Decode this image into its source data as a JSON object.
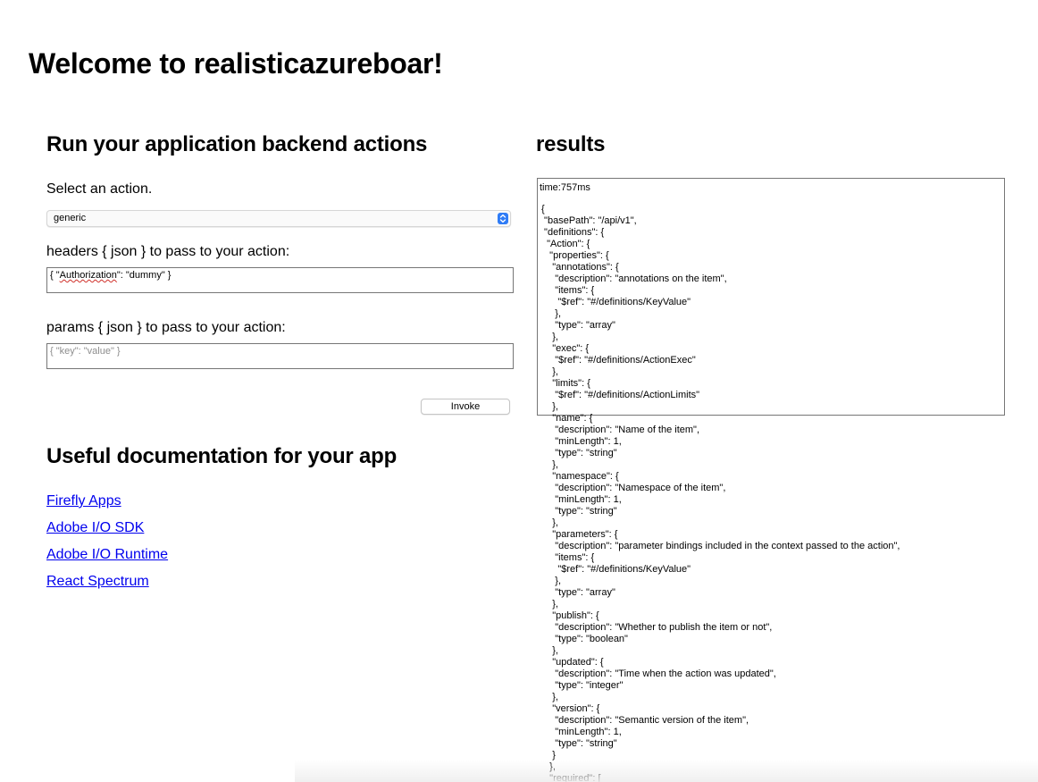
{
  "page": {
    "title": "Welcome to realisticazureboar!"
  },
  "run_panel": {
    "heading": "Run your application backend actions",
    "select_label": "Select an action.",
    "selected_action": "generic",
    "headers_label": "headers { json } to pass to your action:",
    "headers_value_prefix": "{ \"",
    "headers_value_key": "Authorization",
    "headers_value_suffix": "\": \"dummy\" }",
    "params_label": "params { json } to pass to your action:",
    "params_placeholder": "{ \"key\": \"value\" }",
    "invoke_label": "Invoke"
  },
  "docs": {
    "heading": "Useful documentation for your app",
    "links": [
      {
        "label": "Firefly Apps"
      },
      {
        "label": "Adobe I/O SDK"
      },
      {
        "label": "Adobe I/O Runtime"
      },
      {
        "label": "React Spectrum"
      }
    ]
  },
  "results": {
    "heading": "results",
    "time": "time:757ms",
    "json_text": "{\n \"basePath\": \"/api/v1\",\n \"definitions\": {\n  \"Action\": {\n   \"properties\": {\n    \"annotations\": {\n     \"description\": \"annotations on the item\",\n     \"items\": {\n      \"$ref\": \"#/definitions/KeyValue\"\n     },\n     \"type\": \"array\"\n    },\n    \"exec\": {\n     \"$ref\": \"#/definitions/ActionExec\"\n    },\n    \"limits\": {\n     \"$ref\": \"#/definitions/ActionLimits\"\n    },\n    \"name\": {\n     \"description\": \"Name of the item\",\n     \"minLength\": 1,\n     \"type\": \"string\"\n    },\n    \"namespace\": {\n     \"description\": \"Namespace of the item\",\n     \"minLength\": 1,\n     \"type\": \"string\"\n    },\n    \"parameters\": {\n     \"description\": \"parameter bindings included in the context passed to the action\",\n     \"items\": {\n      \"$ref\": \"#/definitions/KeyValue\"\n     },\n     \"type\": \"array\"\n    },\n    \"publish\": {\n     \"description\": \"Whether to publish the item or not\",\n     \"type\": \"boolean\"\n    },\n    \"updated\": {\n     \"description\": \"Time when the action was updated\",\n     \"type\": \"integer\"\n    },\n    \"version\": {\n     \"description\": \"Semantic version of the item\",\n     \"minLength\": 1,\n     \"type\": \"string\"\n    }\n   },\n   \"required\": ["
  },
  "icons": {
    "select_arrows": "updown-chevron-icon"
  },
  "colors": {
    "link": "#0000ee",
    "select_accent": "#2f7cf6",
    "input_border": "#767676"
  }
}
